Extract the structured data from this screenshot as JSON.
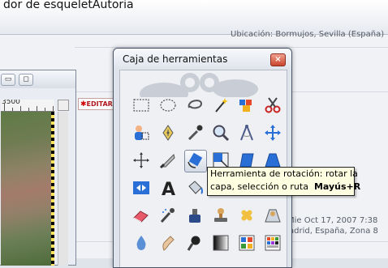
{
  "browser": {
    "title_fragment": "dor de esqueletAutoria"
  },
  "page": {
    "location_line": "Ubicación: Bormujos, Sevilla (España)",
    "edit_label": "EDITAR",
    "date_line": "Mie Oct 17, 2007 7:38",
    "place_line": "adrid, España, Zona 8"
  },
  "image_window": {
    "ruler_label": "3500",
    "buttons": {
      "minimize": "▭",
      "maximize": "◻"
    }
  },
  "toolbox": {
    "title": "Caja de herramientas",
    "close_label": "×",
    "tools": [
      {
        "name": "rect-select-tool",
        "icon": "rect-select-icon"
      },
      {
        "name": "ellipse-select-tool",
        "icon": "ellipse-select-icon"
      },
      {
        "name": "free-select-tool",
        "icon": "lasso-icon"
      },
      {
        "name": "fuzzy-select-tool",
        "icon": "magic-wand-icon"
      },
      {
        "name": "select-by-color-tool",
        "icon": "color-select-icon"
      },
      {
        "name": "scissors-tool",
        "icon": "scissors-icon"
      },
      {
        "name": "foreground-select-tool",
        "icon": "foreground-select-icon"
      },
      {
        "name": "paths-tool",
        "icon": "pen-nib-icon"
      },
      {
        "name": "color-picker-tool",
        "icon": "eyedropper-icon"
      },
      {
        "name": "zoom-tool",
        "icon": "magnifier-icon"
      },
      {
        "name": "measure-tool",
        "icon": "compass-icon"
      },
      {
        "name": "move-tool",
        "icon": "move-arrows-icon"
      },
      {
        "name": "align-tool",
        "icon": "align-icon"
      },
      {
        "name": "crop-tool",
        "icon": "knife-icon"
      },
      {
        "name": "rotate-tool",
        "icon": "rotate-icon"
      },
      {
        "name": "scale-tool",
        "icon": "scale-icon"
      },
      {
        "name": "shear-tool",
        "icon": "shear-icon"
      },
      {
        "name": "perspective-tool",
        "icon": "perspective-icon"
      },
      {
        "name": "flip-tool",
        "icon": "flip-icon"
      },
      {
        "name": "text-tool",
        "icon": "text-a-icon"
      },
      {
        "name": "bucket-fill-tool",
        "icon": "bucket-icon"
      },
      {
        "name": "blend-tool",
        "icon": "blend-icon"
      },
      {
        "name": "pencil-tool",
        "icon": "pencil-icon"
      },
      {
        "name": "paintbrush-tool",
        "icon": "brush-icon"
      },
      {
        "name": "eraser-tool",
        "icon": "eraser-icon"
      },
      {
        "name": "airbrush-tool",
        "icon": "airbrush-icon"
      },
      {
        "name": "ink-tool",
        "icon": "ink-icon"
      },
      {
        "name": "clone-tool",
        "icon": "stamp-icon"
      },
      {
        "name": "heal-tool",
        "icon": "bandage-icon"
      },
      {
        "name": "perspective-clone-tool",
        "icon": "perspective-clone-icon"
      },
      {
        "name": "blur-tool",
        "icon": "water-drop-icon"
      },
      {
        "name": "smudge-tool",
        "icon": "smudge-icon"
      },
      {
        "name": "dodge-burn-tool",
        "icon": "dodge-burn-icon"
      },
      {
        "name": "gradient-swatch",
        "icon": "gradient-icon"
      },
      {
        "name": "patterns-swatch",
        "icon": "patterns-icon"
      },
      {
        "name": "palette-swatch",
        "icon": "palette-icon"
      }
    ]
  },
  "tooltip": {
    "line1": "Herramienta de rotación: rotar la",
    "line2": "capa, selección o ruta",
    "shortcut": "Mayús+R"
  }
}
